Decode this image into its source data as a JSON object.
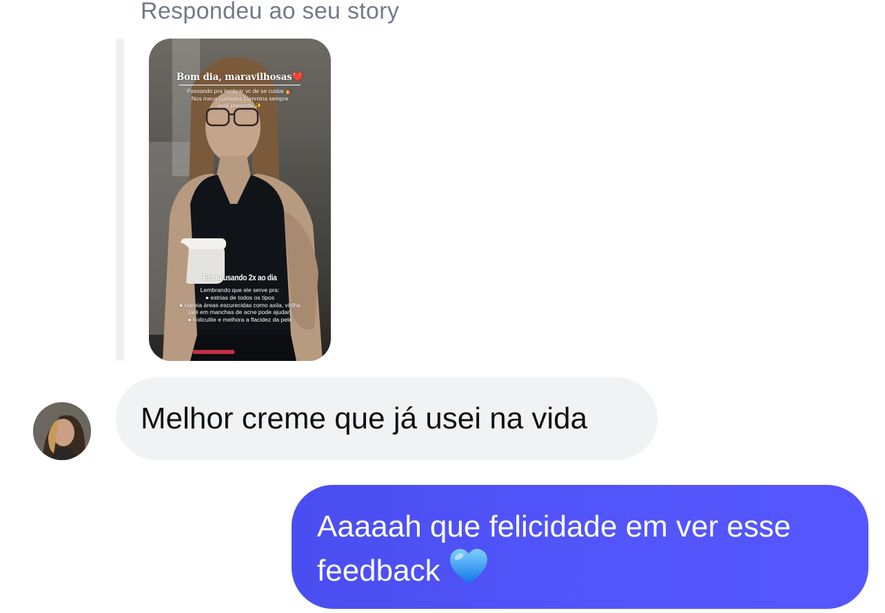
{
  "reply_caption": "Respondeu ao seu story",
  "story": {
    "title": "Bom dia, maravilhosas❤️",
    "subtitle_lines": [
      "Passando pra lembrar vc de se cuidar 💅",
      "Nos meus cuidados Lummina sempre",
      "está presente ✨"
    ],
    "heading": "Estou usando 2x ao dia",
    "list_lines": [
      "Lembrando que ele serve pra:",
      "● estrias de todos os tipos",
      "● clareia áreas escurecidas como axila, virilha",
      "(até em manchas de acne pode ajudar)",
      "● Foliculite e melhora a flacidez da pele"
    ]
  },
  "messages": {
    "incoming": {
      "text": "Melhor creme que já usei na vida",
      "avatar_icon": "user-avatar",
      "bubble_color": "#f1f2f4"
    },
    "outgoing": {
      "lines": [
        "Aaaaah que felicidade em ver esse",
        "feedback"
      ],
      "emoji_icon": "blue-heart-icon",
      "bubble_color": "#5356fb"
    }
  }
}
